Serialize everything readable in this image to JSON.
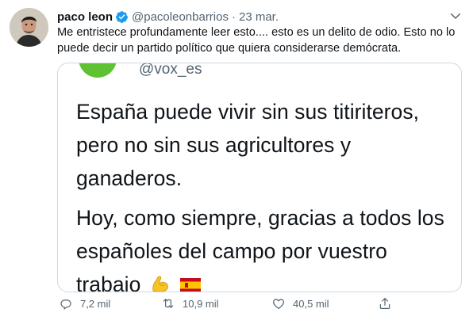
{
  "tweet": {
    "author_name": "paco leon",
    "author_handle": "@pacoleonbarrios",
    "separator": "·",
    "date": "23 mar.",
    "text": "Me entristece profundamente leer esto.... esto es un delito de odio. Esto no lo puede decir un partido político que quiera considerarse demócrata.",
    "verified": true
  },
  "quoted_image": {
    "handle": "@vox_es",
    "paragraph_1": "España puede vivir sin sus titiriteros, pero no sin sus agricultores y ganaderos.",
    "paragraph_2": "Hoy, como siempre, gracias a todos los españoles del campo por vuestro trabajo",
    "emojis": [
      "flexed-biceps",
      "spain-flag"
    ]
  },
  "actions": {
    "replies": "7,2 mil",
    "retweets": "10,9 mil",
    "likes": "40,5 mil"
  },
  "colors": {
    "text": "#0f1419",
    "secondary": "#536471",
    "verified_blue": "#1d9bf0",
    "border": "#cfd9de",
    "vox_green": "#5ec233"
  },
  "icons": [
    "verified-badge-icon",
    "chevron-down-icon",
    "reply-icon",
    "retweet-icon",
    "like-icon",
    "share-icon"
  ]
}
